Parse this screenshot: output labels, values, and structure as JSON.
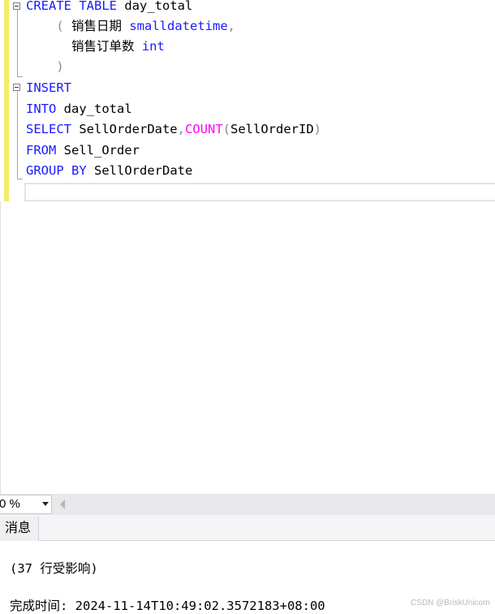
{
  "editor": {
    "lines": [
      {
        "parts": [
          {
            "t": "CREATE TABLE ",
            "c": "kw"
          },
          {
            "t": "day_total",
            "c": ""
          }
        ]
      },
      {
        "parts": [
          {
            "t": "    ( ",
            "c": "gr"
          },
          {
            "t": "销售日期 ",
            "c": ""
          },
          {
            "t": "smalldatetime",
            "c": "kw"
          },
          {
            "t": ",",
            "c": "gr"
          }
        ]
      },
      {
        "parts": [
          {
            "t": "      销售订单数 ",
            "c": ""
          },
          {
            "t": "int",
            "c": "kw"
          }
        ]
      },
      {
        "parts": [
          {
            "t": "    )",
            "c": "gr"
          }
        ]
      },
      {
        "parts": [
          {
            "t": "INSERT",
            "c": "kw"
          }
        ]
      },
      {
        "parts": [
          {
            "t": "INTO ",
            "c": "kw"
          },
          {
            "t": "day_total",
            "c": ""
          }
        ]
      },
      {
        "parts": [
          {
            "t": "SELECT ",
            "c": "kw"
          },
          {
            "t": "SellOrderDate",
            "c": ""
          },
          {
            "t": ",",
            "c": "gr"
          },
          {
            "t": "COUNT",
            "c": "fn"
          },
          {
            "t": "(",
            "c": "gr"
          },
          {
            "t": "SellOrderID",
            "c": ""
          },
          {
            "t": ")",
            "c": "gr"
          }
        ]
      },
      {
        "parts": [
          {
            "t": "FROM ",
            "c": "kw"
          },
          {
            "t": "Sell_Order",
            "c": ""
          }
        ]
      },
      {
        "parts": [
          {
            "t": "GROUP BY ",
            "c": "kw"
          },
          {
            "t": "SellOrderDate",
            "c": ""
          }
        ]
      }
    ]
  },
  "zoom": {
    "value": "0 %"
  },
  "results": {
    "tab_label": "消息",
    "rows_affected": "(37 行受影响)",
    "completion": "完成时间: 2024-11-14T10:49:02.3572183+08:00"
  },
  "watermark": "CSDN @BriskUnicorn"
}
